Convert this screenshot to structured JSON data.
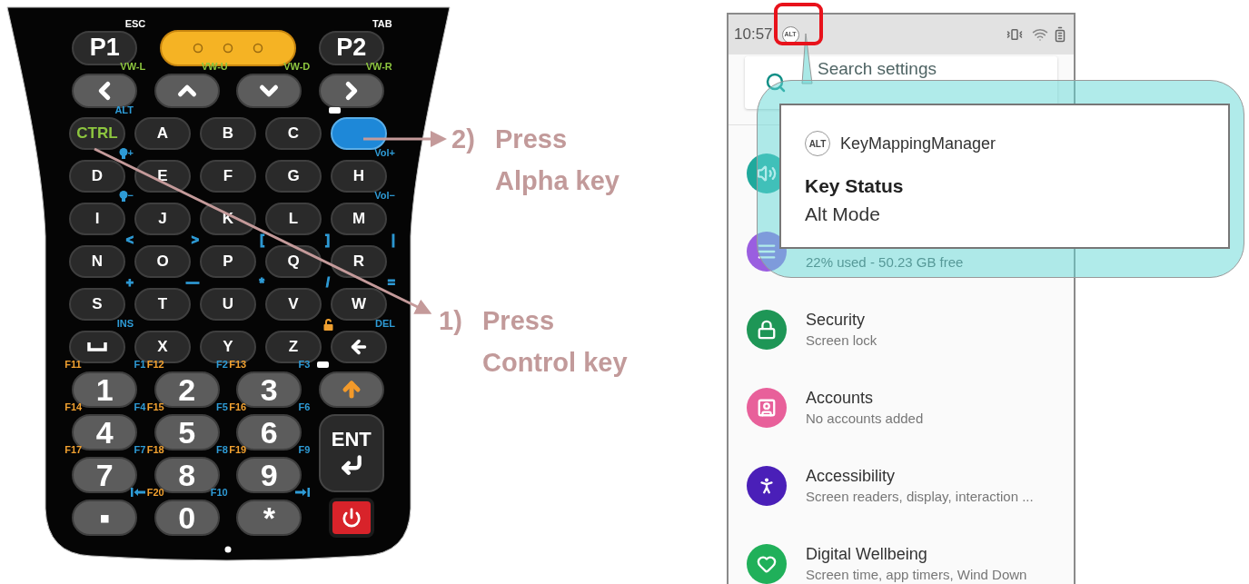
{
  "keypad": {
    "top_rows": [
      [
        {
          "kind": "function",
          "label": "P1",
          "legend_right": {
            "text": "ESC",
            "color": "#ffffff"
          }
        },
        {
          "kind": "scan"
        },
        {
          "kind": "function",
          "label": "P2",
          "legend_right": {
            "text": "TAB",
            "color": "#ffffff"
          }
        }
      ],
      [
        {
          "kind": "arrow-left",
          "legend_right": {
            "text": "VW-L",
            "color": "#8dc63f"
          }
        },
        {
          "kind": "arrow-up",
          "legend_right": {
            "text": "VW-U",
            "color": "#8dc63f"
          }
        },
        {
          "kind": "arrow-down",
          "legend_right": {
            "text": "VW-D",
            "color": "#8dc63f"
          }
        },
        {
          "kind": "arrow-right",
          "legend_right": {
            "text": "VW-R",
            "color": "#8dc63f"
          }
        }
      ]
    ],
    "letter_rows": [
      [
        {
          "kind": "text",
          "label": "CTRL",
          "color": "#8dc63f",
          "legend_right": {
            "text": "ALT",
            "color": "#2e9bd6"
          }
        },
        {
          "kind": "text",
          "label": "A"
        },
        {
          "kind": "text",
          "label": "B"
        },
        {
          "kind": "text",
          "label": "C"
        },
        {
          "kind": "alpha",
          "legend_left": {
            "kind": "indicator"
          }
        }
      ],
      [
        {
          "kind": "text",
          "label": "D",
          "legend_right": {
            "kind": "bulb",
            "text": "+",
            "color": "#2e9bd6"
          }
        },
        {
          "kind": "text",
          "label": "E"
        },
        {
          "kind": "text",
          "label": "F"
        },
        {
          "kind": "text",
          "label": "G"
        },
        {
          "kind": "text",
          "label": "H",
          "legend_right": {
            "text": "Vol+",
            "color": "#2e9bd6"
          }
        }
      ],
      [
        {
          "kind": "text",
          "label": "I",
          "legend_right": {
            "kind": "bulb",
            "text": "−",
            "color": "#2e9bd6"
          }
        },
        {
          "kind": "text",
          "label": "J"
        },
        {
          "kind": "text",
          "label": "K"
        },
        {
          "kind": "text",
          "label": "L"
        },
        {
          "kind": "text",
          "label": "M",
          "legend_right": {
            "text": "Vol−",
            "color": "#2e9bd6"
          }
        }
      ],
      [
        {
          "kind": "text",
          "label": "N",
          "legend_right": {
            "text": "<",
            "color": "#2e9bd6"
          }
        },
        {
          "kind": "text",
          "label": "O",
          "legend_right": {
            "text": ">",
            "color": "#2e9bd6"
          }
        },
        {
          "kind": "text",
          "label": "P",
          "legend_right": {
            "text": "[",
            "color": "#2e9bd6"
          }
        },
        {
          "kind": "text",
          "label": "Q",
          "legend_right": {
            "text": "]",
            "color": "#2e9bd6"
          }
        },
        {
          "kind": "text",
          "label": "R",
          "legend_right": {
            "text": "|",
            "color": "#2e9bd6"
          }
        }
      ],
      [
        {
          "kind": "text",
          "label": "S",
          "legend_right": {
            "text": "+",
            "color": "#2e9bd6"
          }
        },
        {
          "kind": "text",
          "label": "T",
          "legend_right": {
            "text": "—",
            "color": "#2e9bd6"
          }
        },
        {
          "kind": "text",
          "label": "U",
          "legend_right": {
            "text": "*",
            "color": "#2e9bd6"
          }
        },
        {
          "kind": "text",
          "label": "V",
          "legend_right": {
            "text": "/",
            "color": "#2e9bd6"
          }
        },
        {
          "kind": "text",
          "label": "W",
          "legend_right": {
            "text": "=",
            "color": "#2e9bd6"
          }
        }
      ],
      [
        {
          "kind": "space",
          "legend_right": {
            "text": "INS",
            "color": "#2e9bd6"
          }
        },
        {
          "kind": "text",
          "label": "X"
        },
        {
          "kind": "text",
          "label": "Y"
        },
        {
          "kind": "text",
          "label": "Z"
        },
        {
          "kind": "backspace",
          "legend_left": {
            "kind": "lock",
            "color": "#f0a030"
          },
          "legend_right": {
            "text": "DEL",
            "color": "#2e9bd6"
          }
        }
      ]
    ],
    "number_rows": [
      [
        {
          "kind": "number",
          "label": "1",
          "legend_left": {
            "text": "F11",
            "color": "#f0a030"
          },
          "legend_right": {
            "text": "F1",
            "color": "#2e9bd6"
          }
        },
        {
          "kind": "number",
          "label": "2",
          "legend_left": {
            "text": "F12",
            "color": "#f0a030"
          },
          "legend_right": {
            "text": "F2",
            "color": "#2e9bd6"
          }
        },
        {
          "kind": "number",
          "label": "3",
          "legend_left": {
            "text": "F13",
            "color": "#f0a030"
          },
          "legend_right": {
            "text": "F3",
            "color": "#2e9bd6"
          }
        },
        {
          "kind": "shift",
          "legend_left": {
            "kind": "indicator"
          }
        }
      ],
      [
        {
          "kind": "number",
          "label": "4",
          "legend_left": {
            "text": "F14",
            "color": "#f0a030"
          },
          "legend_right": {
            "text": "F4",
            "color": "#2e9bd6"
          }
        },
        {
          "kind": "number",
          "label": "5",
          "legend_left": {
            "text": "F15",
            "color": "#f0a030"
          },
          "legend_right": {
            "text": "F5",
            "color": "#2e9bd6"
          }
        },
        {
          "kind": "number",
          "label": "6",
          "legend_left": {
            "text": "F16",
            "color": "#f0a030"
          },
          "legend_right": {
            "text": "F6",
            "color": "#2e9bd6"
          }
        },
        {
          "kind": "enter",
          "label": "ENT"
        }
      ],
      [
        {
          "kind": "number",
          "label": "7",
          "legend_left": {
            "text": "F17",
            "color": "#f0a030"
          },
          "legend_right": {
            "text": "F7",
            "color": "#2e9bd6"
          }
        },
        {
          "kind": "number",
          "label": "8",
          "legend_left": {
            "text": "F18",
            "color": "#f0a030"
          },
          "legend_right": {
            "text": "F8",
            "color": "#2e9bd6"
          }
        },
        {
          "kind": "number",
          "label": "9",
          "legend_left": {
            "text": "F19",
            "color": "#f0a030"
          },
          "legend_right": {
            "text": "F9",
            "color": "#2e9bd6"
          }
        }
      ],
      [
        {
          "kind": "number",
          "label": "▪",
          "legend_right": {
            "kind": "tab-back",
            "color": "#2e9bd6"
          }
        },
        {
          "kind": "number",
          "label": "0",
          "legend_left": {
            "text": "F20",
            "color": "#f0a030"
          },
          "legend_right": {
            "text": "F10",
            "color": "#2e9bd6"
          }
        },
        {
          "kind": "number",
          "label": "*",
          "legend_right": {
            "kind": "tab-forward",
            "color": "#2e9bd6"
          }
        },
        {
          "kind": "power"
        }
      ]
    ]
  },
  "annotations": [
    {
      "step": "2)",
      "lines": [
        "Press",
        "Alpha key"
      ]
    },
    {
      "step": "1)",
      "lines": [
        "Press",
        "Control key"
      ]
    }
  ],
  "phone": {
    "status_bar": {
      "time": "10:57",
      "alt_icon": "ALT"
    },
    "search": {
      "placeholder": "Search settings"
    },
    "settings": [
      {
        "kind": "sound",
        "color": "#1fa99c"
      },
      {
        "kind": "storage",
        "color": "#9a5ee0",
        "subtitle": "22% used - 50.23 GB free"
      },
      {
        "kind": "security",
        "color": "#1e9656",
        "title": "Security",
        "subtitle": "Screen lock"
      },
      {
        "kind": "accounts",
        "color": "#e8609a",
        "title": "Accounts",
        "subtitle": "No accounts added"
      },
      {
        "kind": "accessibility",
        "color": "#4a1fb8",
        "title": "Accessibility",
        "subtitle": "Screen readers, display, interaction ..."
      },
      {
        "kind": "wellbeing",
        "color": "#20b05a",
        "title": "Digital Wellbeing",
        "subtitle": "Screen time, app timers, Wind Down"
      }
    ]
  },
  "notification": {
    "app_icon": "ALT",
    "app": "KeyMappingManager",
    "title": "Key Status",
    "text": "Alt Mode"
  }
}
